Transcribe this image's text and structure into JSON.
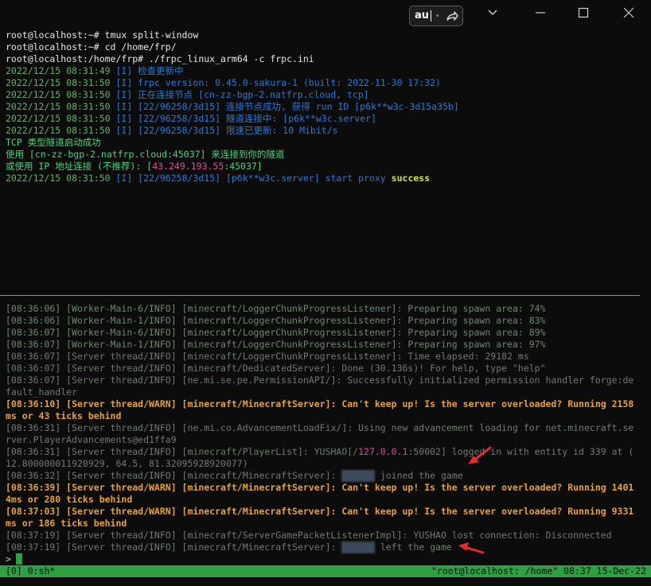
{
  "ime": {
    "text": "au",
    "icon": "share-arrow-icon"
  },
  "window_controls": [
    "chevron-down-icon",
    "minimize-icon",
    "maximize-icon",
    "close-icon"
  ],
  "colors": {
    "background": "#0c0c0c",
    "tmux_green": "#2ea043",
    "warn_orange": "#e8a13a",
    "info_blue": "#2f78d8",
    "success_yellow": "#d0e04a",
    "ip_magenta": "#e14b9a"
  },
  "top_pane": [
    [
      {
        "t": "root@localhost:~# tmux split-window",
        "c": "w"
      }
    ],
    [
      {
        "t": "root@localhost:~# cd /home/frp/",
        "c": "w"
      }
    ],
    [
      {
        "t": "root@localhost:/home/frp# ./frpc_linux_arm64 -c frpc.ini",
        "c": "w"
      }
    ],
    [
      {
        "t": "2022/12/15 08:31:49 ",
        "c": "g"
      },
      {
        "t": "[I] 检查更新中",
        "c": "b"
      }
    ],
    [
      {
        "t": "2022/12/15 08:31:50 ",
        "c": "g"
      },
      {
        "t": "[I] frpc version: 0.45.0-sakura-1 (built: 2022-11-30 17:32)",
        "c": "b"
      }
    ],
    [
      {
        "t": "2022/12/15 08:31:50 ",
        "c": "g"
      },
      {
        "t": "[I] 正在连接节点 [cn-zz-bgp-2.natfrp.cloud, tcp]",
        "c": "b"
      }
    ],
    [
      {
        "t": "2022/12/15 08:31:50 ",
        "c": "g"
      },
      {
        "t": "[I] [22/96258/3d15] 连接节点成功, 获得 run ID [p6k**w3c-3d15a35b]",
        "c": "b"
      }
    ],
    [
      {
        "t": "2022/12/15 08:31:50 ",
        "c": "g"
      },
      {
        "t": "[I] [22/96258/3d15] 隧道连接中: [p6k**w3c.server]",
        "c": "b"
      }
    ],
    [
      {
        "t": "2022/12/15 08:31:50 ",
        "c": "g"
      },
      {
        "t": "[I] [22/96258/3d15] 限速已更新: 10 Mibit/s",
        "c": "b"
      }
    ],
    [
      {
        "t": "TCP 类型隧道启动成功",
        "c": "bg"
      }
    ],
    [
      {
        "t": "使用 [cn-zz-bgp-2.natfrp.cloud:45037] 来连接到你的隧道",
        "c": "bg"
      }
    ],
    [
      {
        "t": "或使用 IP 地址连接 (不推荐): [",
        "c": "bg"
      },
      {
        "t": "43.249.193.55",
        "c": "m"
      },
      {
        "t": ":45037]",
        "c": "bg"
      }
    ],
    [
      {
        "t": "2022/12/15 08:31:50 ",
        "c": "g"
      },
      {
        "t": "[I] [22/96258/3d15] [p6k**w3c.server] start proxy ",
        "c": "b"
      },
      {
        "t": "success",
        "c": "y"
      }
    ]
  ],
  "bottom_pane": [
    [
      {
        "t": "[08:36:06] [Worker-Main-6/INFO] [minecraft/LoggerChunkProgressListener]: Preparing spawn area: 74%",
        "c": "gr"
      }
    ],
    [
      {
        "t": "[08:36:06] [Worker-Main-1/INFO] [minecraft/LoggerChunkProgressListener]: Preparing spawn area: 83%",
        "c": "gr"
      }
    ],
    [
      {
        "t": "[08:36:07] [Worker-Main-6/INFO] [minecraft/LoggerChunkProgressListener]: Preparing spawn area: 89%",
        "c": "gr"
      }
    ],
    [
      {
        "t": "[08:36:07] [Worker-Main-1/INFO] [minecraft/LoggerChunkProgressListener]: Preparing spawn area: 97%",
        "c": "gr"
      }
    ],
    [
      {
        "t": "[08:36:07] [Server thread/INFO] [minecraft/LoggerChunkProgressListener]: Time elapsed: 29182 ms",
        "c": "gy"
      }
    ],
    [
      {
        "t": "[08:36:07] [Server thread/INFO] [minecraft/DedicatedServer]: Done (30.136s)! For help, type \"help\"",
        "c": "gy"
      }
    ],
    [
      {
        "t": "[08:36:07] [Server thread/INFO] [ne.mi.se.pe.PermissionAPI/]: Successfully initialized permission handler forge:de",
        "c": "gy"
      }
    ],
    [
      {
        "t": "fault_handler",
        "c": "gy"
      }
    ],
    [
      {
        "t": "[08:36:10] [Server thread/WARN] [minecraft/MinecraftServer]: Can't keep up! Is the server overloaded? Running 2158",
        "c": "o"
      }
    ],
    [
      {
        "t": "ms or 43 ticks behind",
        "c": "o"
      }
    ],
    [
      {
        "t": "[08:36:31] [Server thread/INFO] [ne.mi.co.AdvancementLoadFix/]: Using new advancement loading for net.minecraft.se",
        "c": "gy"
      }
    ],
    [
      {
        "t": "rver.PlayerAdvancements@ed1ffa9",
        "c": "gy"
      }
    ],
    [
      {
        "t": "[08:36:31] [Server thread/INFO] [minecraft/PlayerList]: YUSHAO[/",
        "c": "gy"
      },
      {
        "t": "127.0.0.1",
        "c": "m"
      },
      {
        "t": ":50002] logged in with entity id 339 at (",
        "c": "gy"
      }
    ],
    [
      {
        "t": "12.800000011920929, 64.5, 81.32095928920077)",
        "c": "gy"
      }
    ],
    [
      {
        "t": "[08:36:32] [Server thread/INFO] [minecraft/MinecraftServer]: ",
        "c": "gy"
      },
      {
        "t": "YUSHAO",
        "c": "blur"
      },
      {
        "t": " joined the game",
        "c": "gy"
      }
    ],
    [
      {
        "t": "[08:36:39] [Server thread/WARN] [minecraft/MinecraftServer]: Can't keep up! Is the server overloaded? Running 1401",
        "c": "o"
      }
    ],
    [
      {
        "t": "4ms or 280 ticks behind",
        "c": "o"
      }
    ],
    [
      {
        "t": "[08:37:03] [Server thread/WARN] [minecraft/MinecraftServer]: Can't keep up! Is the server overloaded? Running 9331",
        "c": "o"
      }
    ],
    [
      {
        "t": "ms or 186 ticks behind",
        "c": "o"
      }
    ],
    [
      {
        "t": "[08:37:19] [Server thread/INFO] [minecraft/ServerGamePacketListenerImpl]: YUSHAO lost connection: Disconnected",
        "c": "gy"
      }
    ],
    [
      {
        "t": "[08:37:19] [Server thread/INFO] [minecraft/MinecraftServer]: ",
        "c": "gy"
      },
      {
        "t": "YUSHAO",
        "c": "blur"
      },
      {
        "t": " left the game",
        "c": "gy"
      }
    ]
  ],
  "prompt": ">",
  "statusbar": {
    "left": "[0] 0:sh*",
    "right": "\"root@localhost: /home\" 08:37 15-Dec-22"
  }
}
